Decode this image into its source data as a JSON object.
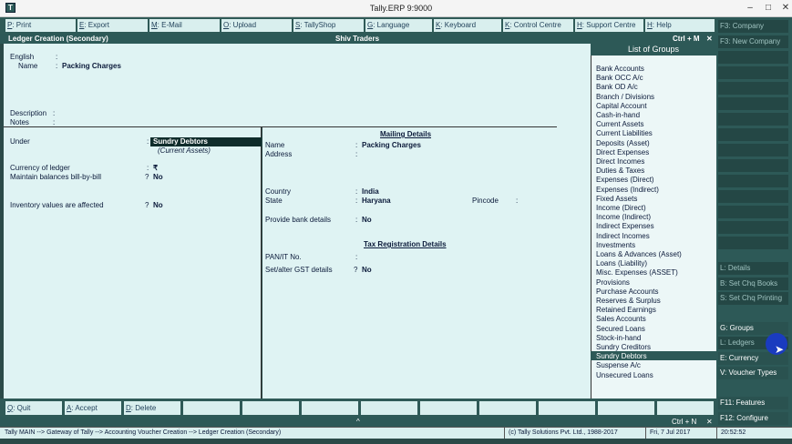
{
  "window": {
    "title": "Tally.ERP 9:9000",
    "icon": "app-icon"
  },
  "toolbar": [
    {
      "key": "P",
      "label": ": Print"
    },
    {
      "key": "E",
      "label": ": Export"
    },
    {
      "key": "M",
      "label": ": E-Mail"
    },
    {
      "key": "O",
      "label": ": Upload"
    },
    {
      "key": "S",
      "label": ": TallyShop"
    },
    {
      "key": "G",
      "label": ": Language"
    },
    {
      "key": "K",
      "label": ": Keyboard"
    },
    {
      "key": "K",
      "label": ": Control Centre"
    },
    {
      "key": "H",
      "label": ": Support Centre"
    },
    {
      "key": "H",
      "label": ": Help"
    }
  ],
  "header": {
    "screen_title": "Ledger Creation (Secondary)",
    "company": "Shiv Traders",
    "shortcut": "Ctrl + M"
  },
  "form": {
    "language_label": "English",
    "name_label": "Name",
    "name_value": "Packing Charges",
    "description_label": "Description",
    "notes_label": "Notes",
    "colon": ":",
    "under_label": "Under",
    "under_value": "Sundry Debtors",
    "under_sub": "(Current Assets)",
    "currency_label": "Currency of ledger",
    "currency_value": "₹",
    "billwise_label": "Maintain balances bill-by-bill",
    "billwise_value": "No",
    "inventory_label": "Inventory values are affected",
    "inventory_value": "No",
    "qmark": "?"
  },
  "mailing": {
    "heading": "Mailing Details",
    "name_label": "Name",
    "name_value": "Packing Charges",
    "address_label": "Address",
    "country_label": "Country",
    "country_value": "India",
    "state_label": "State",
    "state_value": "Haryana",
    "pincode_label": "Pincode",
    "bank_label": "Provide bank details",
    "bank_value": "No"
  },
  "tax": {
    "heading": "Tax Registration Details",
    "pan_label": "PAN/IT No.",
    "gst_label": "Set/alter GST details",
    "gst_value": "No"
  },
  "list_of_groups": {
    "title": "List of Groups",
    "selected": "Sundry Debtors",
    "items": [
      "Bank Accounts",
      "Bank OCC A/c",
      "Bank OD A/c",
      "Branch / Divisions",
      "Capital Account",
      "Cash-in-hand",
      "Current Assets",
      "Current Liabilities",
      "Deposits (Asset)",
      "Direct Expenses",
      "Direct Incomes",
      "Duties & Taxes",
      "Expenses (Direct)",
      "Expenses (Indirect)",
      "Fixed Assets",
      "Income (Direct)",
      "Income (Indirect)",
      "Indirect Expenses",
      "Indirect Incomes",
      "Investments",
      "Loans & Advances (Asset)",
      "Loans (Liability)",
      "Misc. Expenses (ASSET)",
      "Provisions",
      "Purchase Accounts",
      "Reserves & Surplus",
      "Retained Earnings",
      "Sales Accounts",
      "Secured Loans",
      "Stock-in-hand",
      "Sundry Creditors",
      "Sundry Debtors",
      "Suspense A/c",
      "Unsecured Loans"
    ]
  },
  "sidebar": {
    "top": [
      {
        "label": "F3: Company",
        "active": false
      },
      {
        "label": "F3: New Company",
        "active": false
      }
    ],
    "bottom": [
      {
        "label": "L: Details",
        "active": false
      },
      {
        "label": "B: Set Chq Books",
        "active": false
      },
      {
        "label": "S: Set Chq Printing",
        "active": false
      },
      {
        "label": "G: Groups",
        "active": true
      },
      {
        "label": "L: Ledgers",
        "active": false
      },
      {
        "label": "E: Currency",
        "active": true
      },
      {
        "label": "V: Voucher Types",
        "active": true
      },
      {
        "label": "F11: Features",
        "active": true
      },
      {
        "label": "F12: Configure",
        "active": true
      }
    ]
  },
  "bottombar": [
    {
      "key": "Q",
      "label": ": Quit"
    },
    {
      "key": "A",
      "label": ": Accept"
    },
    {
      "key": "D",
      "label": ": Delete"
    }
  ],
  "status": {
    "shortcut": "Ctrl + N",
    "up_arrow": "^",
    "breadcrumb": "Tally MAIN --> Gateway of Tally --> Accounting Voucher Creation --> Ledger Creation (Secondary)",
    "copyright": "(c) Tally Solutions Pvt. Ltd., 1988-2017",
    "date": "Fri, 7 Jul 2017",
    "time": "20:52:52"
  }
}
